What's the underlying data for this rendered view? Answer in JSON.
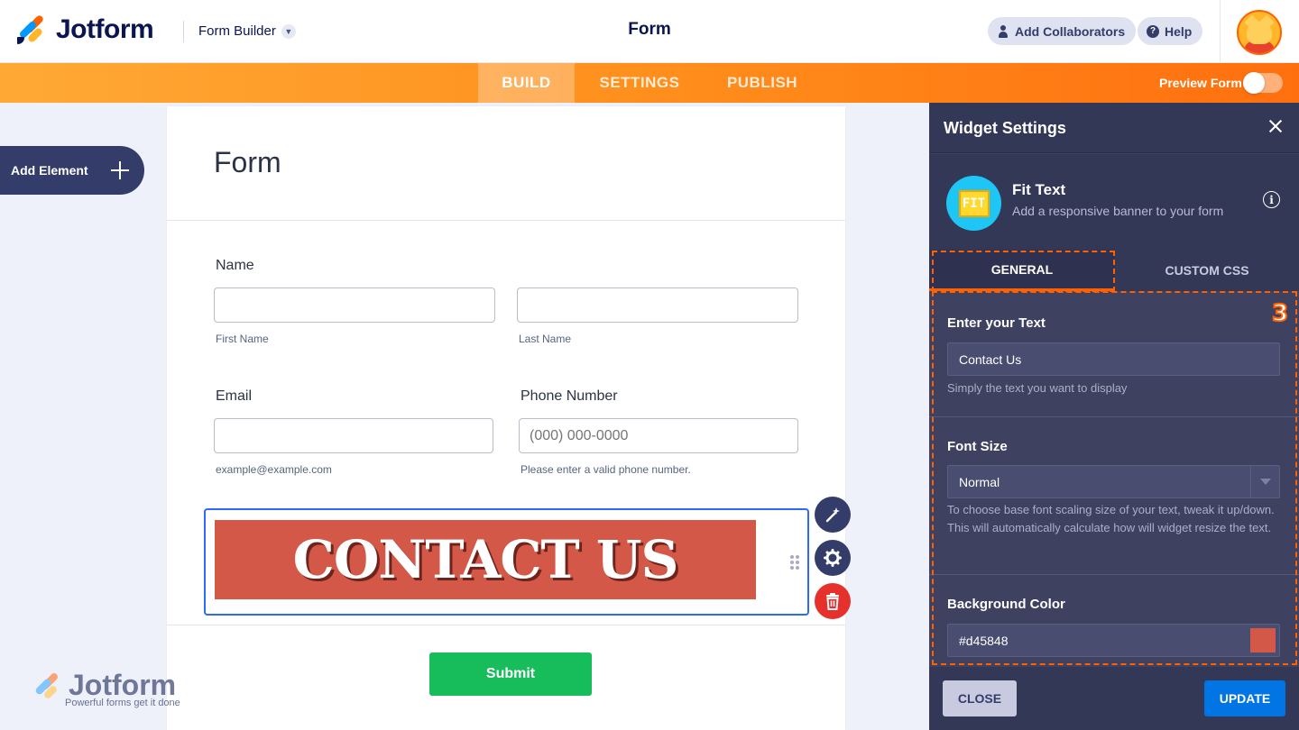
{
  "header": {
    "logo_text": "Jotform",
    "mode_label": "Form Builder",
    "title": "Form",
    "collaborators_label": "Add Collaborators",
    "help_label": "Help"
  },
  "nav": {
    "tabs": [
      {
        "label": "BUILD",
        "active": true
      },
      {
        "label": "SETTINGS",
        "active": false
      },
      {
        "label": "PUBLISH",
        "active": false
      }
    ],
    "preview_label": "Preview Form",
    "preview_on": false
  },
  "sidebar": {
    "add_element_label": "Add Element"
  },
  "form": {
    "heading": "Form",
    "name_label": "Name",
    "first_name_sublabel": "First Name",
    "last_name_sublabel": "Last Name",
    "email_label": "Email",
    "email_sublabel": "example@example.com",
    "phone_label": "Phone Number",
    "phone_placeholder": "(000) 000-0000",
    "phone_sublabel": "Please enter a valid phone number.",
    "banner_text": "CONTACT US",
    "submit_label": "Submit"
  },
  "watermark": {
    "brand": "Jotform",
    "tagline": "Powerful forms get it done"
  },
  "panel": {
    "title": "Widget Settings",
    "widget_name": "Fit Text",
    "widget_description": "Add a responsive banner to your form",
    "widget_icon_text": "FIT",
    "tabs": [
      {
        "label": "GENERAL",
        "active": true
      },
      {
        "label": "CUSTOM CSS",
        "active": false
      }
    ],
    "step_marker": "3",
    "text_label": "Enter your Text",
    "text_value": "Contact Us",
    "text_help": "Simply the text you want to display",
    "font_size_label": "Font Size",
    "font_size_value": "Normal",
    "font_size_help": "To choose base font scaling size of your text, tweak it up/down. This will automatically calculate how will widget resize the text.",
    "bg_color_label": "Background Color",
    "bg_color_value": "#d45848",
    "close_label": "CLOSE",
    "update_label": "UPDATE"
  },
  "colors": {
    "brand_orange": "#ff6100",
    "banner_bg": "#d45848",
    "submit_green": "#18bd5b",
    "update_blue": "#0075e3",
    "panel_bg": "#3e4160"
  }
}
